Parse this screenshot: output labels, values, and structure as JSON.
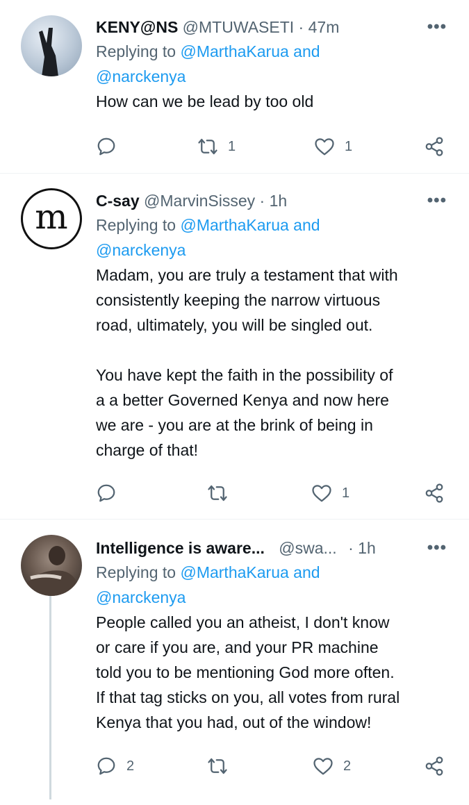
{
  "tweets": [
    {
      "name": "KENY@NS",
      "handle": "@MTUWASETI",
      "dot": "·",
      "time": "47m",
      "more": "•••",
      "replying_prefix": "Replying to ",
      "mention1": "@MarthaKarua",
      "and": " and",
      "mention2": "@narckenya",
      "text": "How can we be lead by too old",
      "reply_count": "",
      "retweet_count": "1",
      "like_count": "1"
    },
    {
      "name": "C-say",
      "handle": "@MarvinSissey",
      "dot": "·",
      "time": "1h",
      "more": "•••",
      "avatar_letter": "m",
      "replying_prefix": "Replying to ",
      "mention1": "@MarthaKarua",
      "and": " and",
      "mention2": "@narckenya",
      "text": "Madam, you are truly a testament that with\nconsistently keeping the narrow virtuous\nroad, ultimately, you will be singled out.\n\nYou have kept the faith in the possibility of\na a better Governed Kenya and now here\nwe are - you are at the brink of being in\ncharge of that!",
      "reply_count": "",
      "retweet_count": "",
      "like_count": "1"
    },
    {
      "name": "Intelligence is aware...",
      "handle": "@swa...",
      "dot": "·",
      "time": "1h",
      "more": "•••",
      "replying_prefix": "Replying to ",
      "mention1": "@MarthaKarua",
      "and": " and",
      "mention2": "@narckenya",
      "text": "People called you an atheist, I don't know\nor care if you are, and your PR machine\ntold you to be mentioning God more often.\nIf that tag sticks on you, all votes from rural\nKenya that you had, out of the window!",
      "reply_count": "2",
      "retweet_count": "",
      "like_count": "2"
    }
  ],
  "icons": {
    "reply": "reply-icon",
    "retweet": "retweet-icon",
    "like": "heart-icon",
    "share": "share-icon"
  },
  "colors": {
    "link": "#1d9bf0",
    "secondary_text": "#536471",
    "divider": "#eff3f4"
  }
}
